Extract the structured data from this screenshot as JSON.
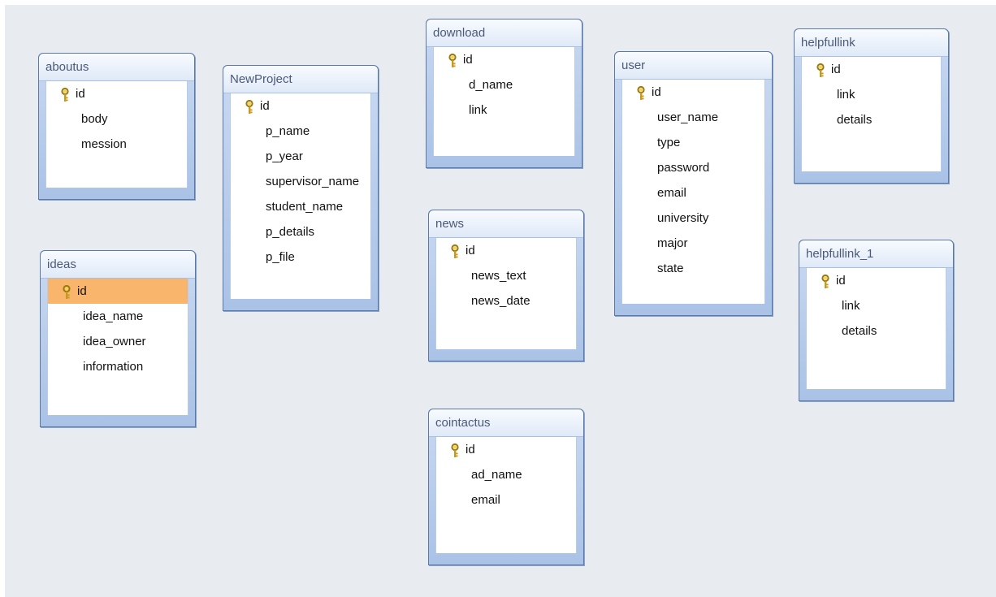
{
  "tables": [
    {
      "name": "aboutus",
      "fields": [
        "id",
        "body",
        "mession"
      ],
      "key_field": 0,
      "selected_field": null
    },
    {
      "name": "ideas",
      "fields": [
        "id",
        "idea_name",
        "idea_owner",
        "information"
      ],
      "key_field": 0,
      "selected_field": 0
    },
    {
      "name": "NewProject",
      "fields": [
        "id",
        "p_name",
        "p_year",
        "supervisor_name",
        "student_name",
        "p_details",
        "p_file"
      ],
      "key_field": 0,
      "selected_field": null
    },
    {
      "name": "download",
      "fields": [
        "id",
        "d_name",
        "link"
      ],
      "key_field": 0,
      "selected_field": null
    },
    {
      "name": "news",
      "fields": [
        "id",
        "news_text",
        "news_date"
      ],
      "key_field": 0,
      "selected_field": null
    },
    {
      "name": "cointactus",
      "fields": [
        "id",
        "ad_name",
        "email"
      ],
      "key_field": 0,
      "selected_field": null
    },
    {
      "name": "user",
      "fields": [
        "id",
        "user_name",
        "type",
        "password",
        "email",
        "university",
        "major",
        "state"
      ],
      "key_field": 0,
      "selected_field": null
    },
    {
      "name": "helpfullink",
      "fields": [
        "id",
        "link",
        "details"
      ],
      "key_field": 0,
      "selected_field": null
    },
    {
      "name": "helpfullink_1",
      "fields": [
        "id",
        "link",
        "details"
      ],
      "key_field": 0,
      "selected_field": null
    }
  ],
  "icons": {
    "primary_key": "key-icon"
  },
  "colors": {
    "canvas": "#e8ebef",
    "header_text": "#4a5a78",
    "border": "#5a78a8",
    "selected_row": "#f9b56b"
  }
}
